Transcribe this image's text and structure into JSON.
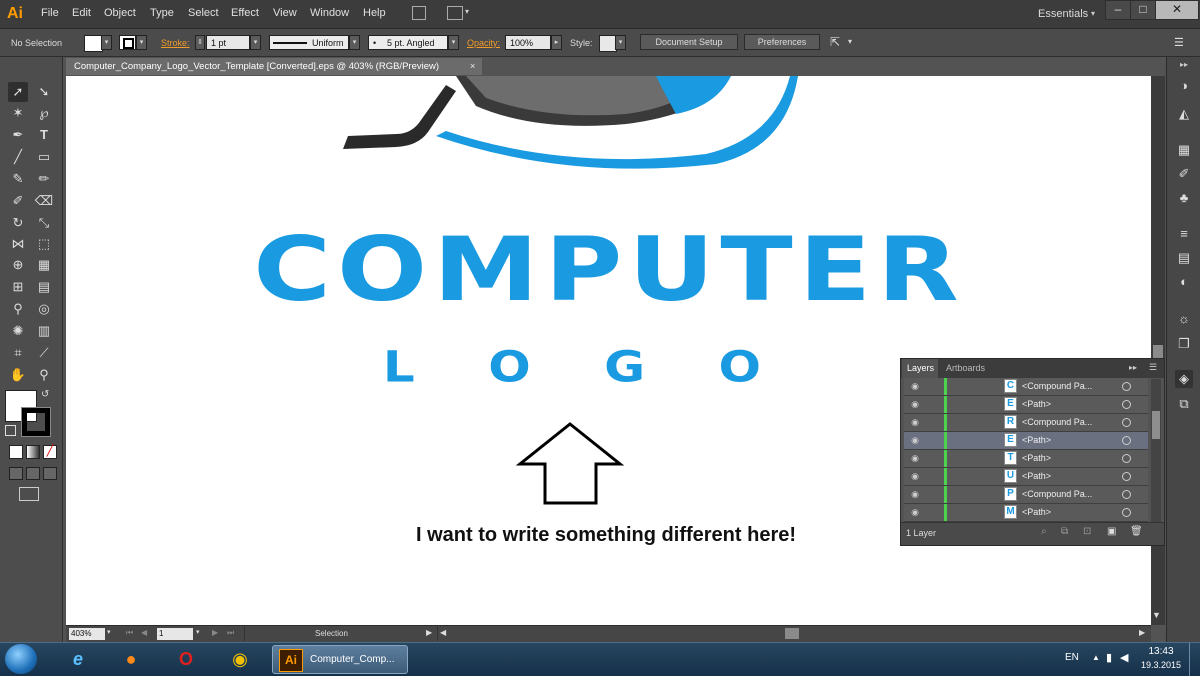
{
  "app": {
    "logo": "Ai"
  },
  "menu": [
    "File",
    "Edit",
    "Object",
    "Type",
    "Select",
    "Effect",
    "View",
    "Window",
    "Help"
  ],
  "workspace": "Essentials",
  "window_buttons": {
    "minimize": "–",
    "maximize": "□",
    "close": "✕"
  },
  "control_bar": {
    "selection": "No Selection",
    "stroke_label": "Stroke:",
    "stroke_weight": "1 pt",
    "profile": "Uniform",
    "brush": "5 pt. Angled",
    "opacity_label": "Opacity:",
    "opacity": "100%",
    "style_label": "Style:",
    "doc_setup": "Document Setup",
    "preferences": "Preferences"
  },
  "document_tab": {
    "title": "Computer_Company_Logo_Vector_Template [Converted].eps @ 403% (RGB/Preview)",
    "close": "×"
  },
  "artwork": {
    "word1": "COMPUTER",
    "word2": "L O G O",
    "annotation": "I want to write something different here!",
    "brand_color": "#1a9ae0"
  },
  "status_bar": {
    "zoom": "403%",
    "page": "1",
    "tool": "Selection"
  },
  "layers_panel": {
    "tabs": [
      "Layers",
      "Artboards"
    ],
    "rows": [
      {
        "glyph": "C",
        "name": "<Compound Pa..."
      },
      {
        "glyph": "E",
        "name": "<Path>"
      },
      {
        "glyph": "R",
        "name": "<Compound Pa..."
      },
      {
        "glyph": "E",
        "name": "<Path>"
      },
      {
        "glyph": "T",
        "name": "<Path>"
      },
      {
        "glyph": "U",
        "name": "<Path>"
      },
      {
        "glyph": "P",
        "name": "<Compound Pa..."
      },
      {
        "glyph": "M",
        "name": "<Path>"
      }
    ],
    "footer": "1 Layer"
  },
  "taskbar": {
    "task_label": "Computer_Comp...",
    "language": "EN",
    "time": "13:43",
    "date": "19.3.2015"
  }
}
